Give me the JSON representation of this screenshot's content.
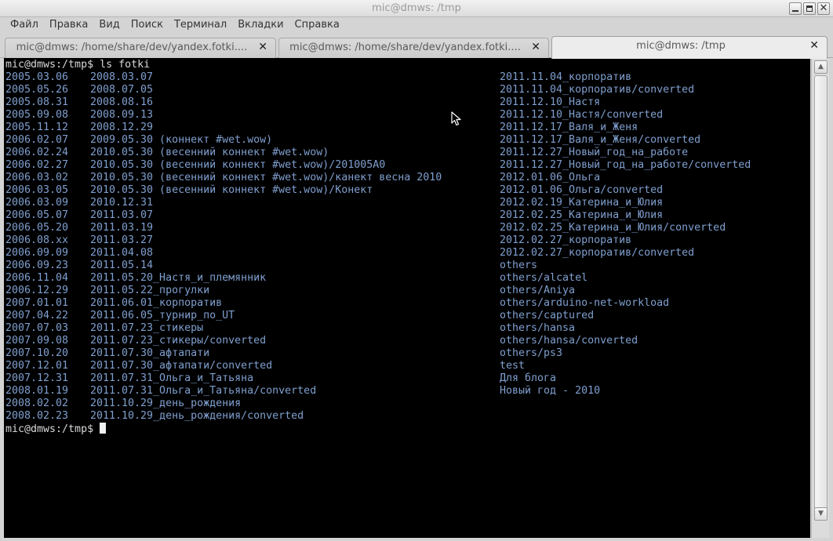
{
  "window": {
    "title": "mic@dmws: /tmp",
    "buttons": [
      "minimize",
      "maximize",
      "close"
    ]
  },
  "menu": [
    "Файл",
    "Правка",
    "Вид",
    "Поиск",
    "Терминал",
    "Вкладки",
    "Справка"
  ],
  "tabs": [
    {
      "label": "mic@dmws: /home/share/dev/yandex.fotki....",
      "active": false,
      "close": "✕"
    },
    {
      "label": "mic@dmws: /home/share/dev/yandex.fotki....",
      "active": false,
      "close": "✕"
    },
    {
      "label": "mic@dmws: /tmp",
      "active": true,
      "close": "✕"
    }
  ],
  "terminal": {
    "prompt": "mic@dmws:/tmp$",
    "command": "ls fotki",
    "colors": {
      "background": "#000000",
      "dir": "#7f9fcf",
      "text": "#d8d8d8"
    },
    "listing_rows": [
      [
        "2005.03.06",
        "2008.03.07",
        "2011.11.04_корпоратив"
      ],
      [
        "2005.05.26",
        "2008.07.05",
        "2011.11.04_корпоратив/converted"
      ],
      [
        "2005.08.31",
        "2008.08.16",
        "2011.12.10_Настя"
      ],
      [
        "2005.09.08",
        "2008.09.13",
        "2011.12.10_Настя/converted"
      ],
      [
        "2005.11.12",
        "2008.12.29",
        "2011.12.17_Валя_и_Женя"
      ],
      [
        "2006.02.07",
        "2009.05.30 (коннект #wet.wow)",
        "2011.12.17_Валя_и_Женя/converted"
      ],
      [
        "2006.02.24",
        "2010.05.30 (весенний коннект #wet.wow)",
        "2011.12.27_Новый_год_на_работе"
      ],
      [
        "2006.02.27",
        "2010.05.30 (весенний коннект #wet.wow)/201005A0",
        "2011.12.27_Новый_год_на_работе/converted"
      ],
      [
        "2006.03.02",
        "2010.05.30 (весенний коннект #wet.wow)/канект весна 2010",
        "2012.01.06_Ольга"
      ],
      [
        "2006.03.05",
        "2010.05.30 (весенний коннект #wet.wow)/Конект",
        "2012.01.06_Ольга/converted"
      ],
      [
        "2006.03.09",
        "2010.12.31",
        "2012.02.19_Катерина_и_Юлия"
      ],
      [
        "2006.05.07",
        "2011.03.07",
        "2012.02.25_Катерина_и_Юлия"
      ],
      [
        "2006.05.20",
        "2011.03.19",
        "2012.02.25_Катерина_и_Юлия/converted"
      ],
      [
        "2006.08.xx",
        "2011.03.27",
        "2012.02.27_корпоратив"
      ],
      [
        "2006.09.09",
        "2011.04.08",
        "2012.02.27_корпоратив/converted"
      ],
      [
        "2006.09.23",
        "2011.05.14",
        "others"
      ],
      [
        "2006.11.04",
        "2011.05.20_Настя_и_племянник",
        "others/alcatel"
      ],
      [
        "2006.12.29",
        "2011.05.22_прогулки",
        "others/Aniya"
      ],
      [
        "2007.01.01",
        "2011.06.01_корпоратив",
        "others/arduino-net-workload"
      ],
      [
        "2007.04.22",
        "2011.06.05_турнир_по_UT",
        "others/captured"
      ],
      [
        "2007.07.03",
        "2011.07.23_стикеры",
        "others/hansa"
      ],
      [
        "2007.09.08",
        "2011.07.23_стикеры/converted",
        "others/hansa/converted"
      ],
      [
        "2007.10.20",
        "2011.07.30_афтапати",
        "others/ps3"
      ],
      [
        "2007.12.01",
        "2011.07.30_афтапати/converted",
        "test"
      ],
      [
        "2007.12.31",
        "2011.07.31_Ольга_и_Татьяна",
        "Для блога"
      ],
      [
        "2008.01.19",
        "2011.07.31_Ольга_и_Татьяна/converted",
        "Новый год - 2010"
      ],
      [
        "2008.02.02",
        "2011.10.29_день_рождения",
        ""
      ],
      [
        "2008.02.23",
        "2011.10.29_день_рождения/converted",
        ""
      ]
    ]
  },
  "scrollbar": {
    "up": "▲",
    "down": "▼"
  }
}
